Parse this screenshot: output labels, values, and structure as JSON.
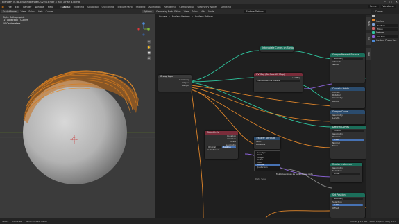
{
  "window": {
    "title": "Blender* [C:\\BLENDER\\Blender\\2022\\03 Hair 3 Hair 3\\Hair 3.blend]"
  },
  "menu": {
    "items": [
      "File",
      "Edit",
      "Render",
      "Window",
      "Help"
    ],
    "tabs": [
      "Layout",
      "Modeling",
      "Sculpting",
      "UV Editing",
      "Texture Paint",
      "Shading",
      "Animation",
      "Rendering",
      "Compositing",
      "Geometry Nodes",
      "Scripting"
    ],
    "active_tab": "Layout",
    "scene": "Scene",
    "view_layer": "ViewLayer"
  },
  "viewport": {
    "mode": "Sculpt Mode",
    "menus": [
      "View",
      "Select",
      "Hair",
      "Curves"
    ],
    "view_name": "Right Orthographic",
    "collection": "(1) Collection | Curves",
    "distance": "10 Centimeters",
    "options": "Options"
  },
  "node_editor": {
    "header_items": [
      "Geometry Node Editor",
      "View",
      "Select",
      "Add",
      "Node"
    ],
    "node_group": "Surface Deform",
    "breadcrumb": [
      "Curves",
      "Surface Deform",
      "Surface Deform"
    ],
    "nodes": {
      "group_input": {
        "title": "Group Input",
        "outputs": [
          "Geometry",
          "Object",
          "Length"
        ]
      },
      "uv_map": {
        "title": "UV Map (Surface UV Map)",
        "label": "UV Map",
        "field": "Sinkable with a to save"
      },
      "capture_top": {
        "title": "Interpolate Curves on Surface"
      },
      "sample_surface": {
        "title": "Sample Nearest Surface",
        "rows": [
          "Geometry",
          "Attribute",
          "Name"
        ]
      },
      "object_info": {
        "title": "Object Info",
        "rows": [
          "Location",
          "Rotation",
          "Scale",
          "Geometry"
        ],
        "buttons": [
          "Original",
          "Relative"
        ],
        "checkbox": "As Instance"
      },
      "transfer": {
        "title": "Transfer Attribute",
        "rows": [
          "Float",
          "Attribute",
          "Vector"
        ]
      },
      "curve_a": {
        "title": "Curve to Points",
        "rows": [
          "Curves",
          "Rotation",
          "Geometry",
          "Radius"
        ]
      },
      "curve_b": {
        "title": "Sample Curve",
        "rows": [
          "Geometry",
          "Length",
          "Count"
        ]
      },
      "deform": {
        "title": "Deform Curves",
        "rows": [
          "Curves",
          "Geometry",
          "Position",
          "Normal",
          "Mesh"
        ],
        "value": "0.000"
      },
      "bottom": {
        "title": "Set Position",
        "rows": [
          "Geometry",
          "Selection",
          "Position",
          "Offset"
        ],
        "value": "0.000"
      },
      "realize": {
        "title": "Realize Instances",
        "rows": [
          "Geometry",
          "Selection",
          "Offset",
          "Value"
        ]
      }
    },
    "dropdown": {
      "header": "Data Type",
      "items": [
        "Float",
        "Integer",
        "Vector",
        "Color",
        "Boolean",
        "Quaternion"
      ],
      "selected": "Boolean"
    },
    "tooltip": "Multiple values as face-corner data",
    "tooltip_sub": "Data Type"
  },
  "properties": {
    "object": "Curves",
    "sections": [
      "Surface",
      "Deform",
      "UV Map"
    ],
    "fields": [
      "Surface",
      "Mesh",
      "Custom Properties"
    ]
  },
  "status": {
    "left": [
      "Select",
      "Pan View",
      "Node Context Menu"
    ],
    "right": "Memory 1.0 GiB | VRAM 1.0/16.0 GiB | 3.2.0"
  },
  "colors": {
    "hair": "#e58d2a",
    "wire_green": "#2fc7a0",
    "wire_orange": "#e0862b",
    "wire_purple": "#8c63d9",
    "wire_grey": "#8a8a8a"
  }
}
